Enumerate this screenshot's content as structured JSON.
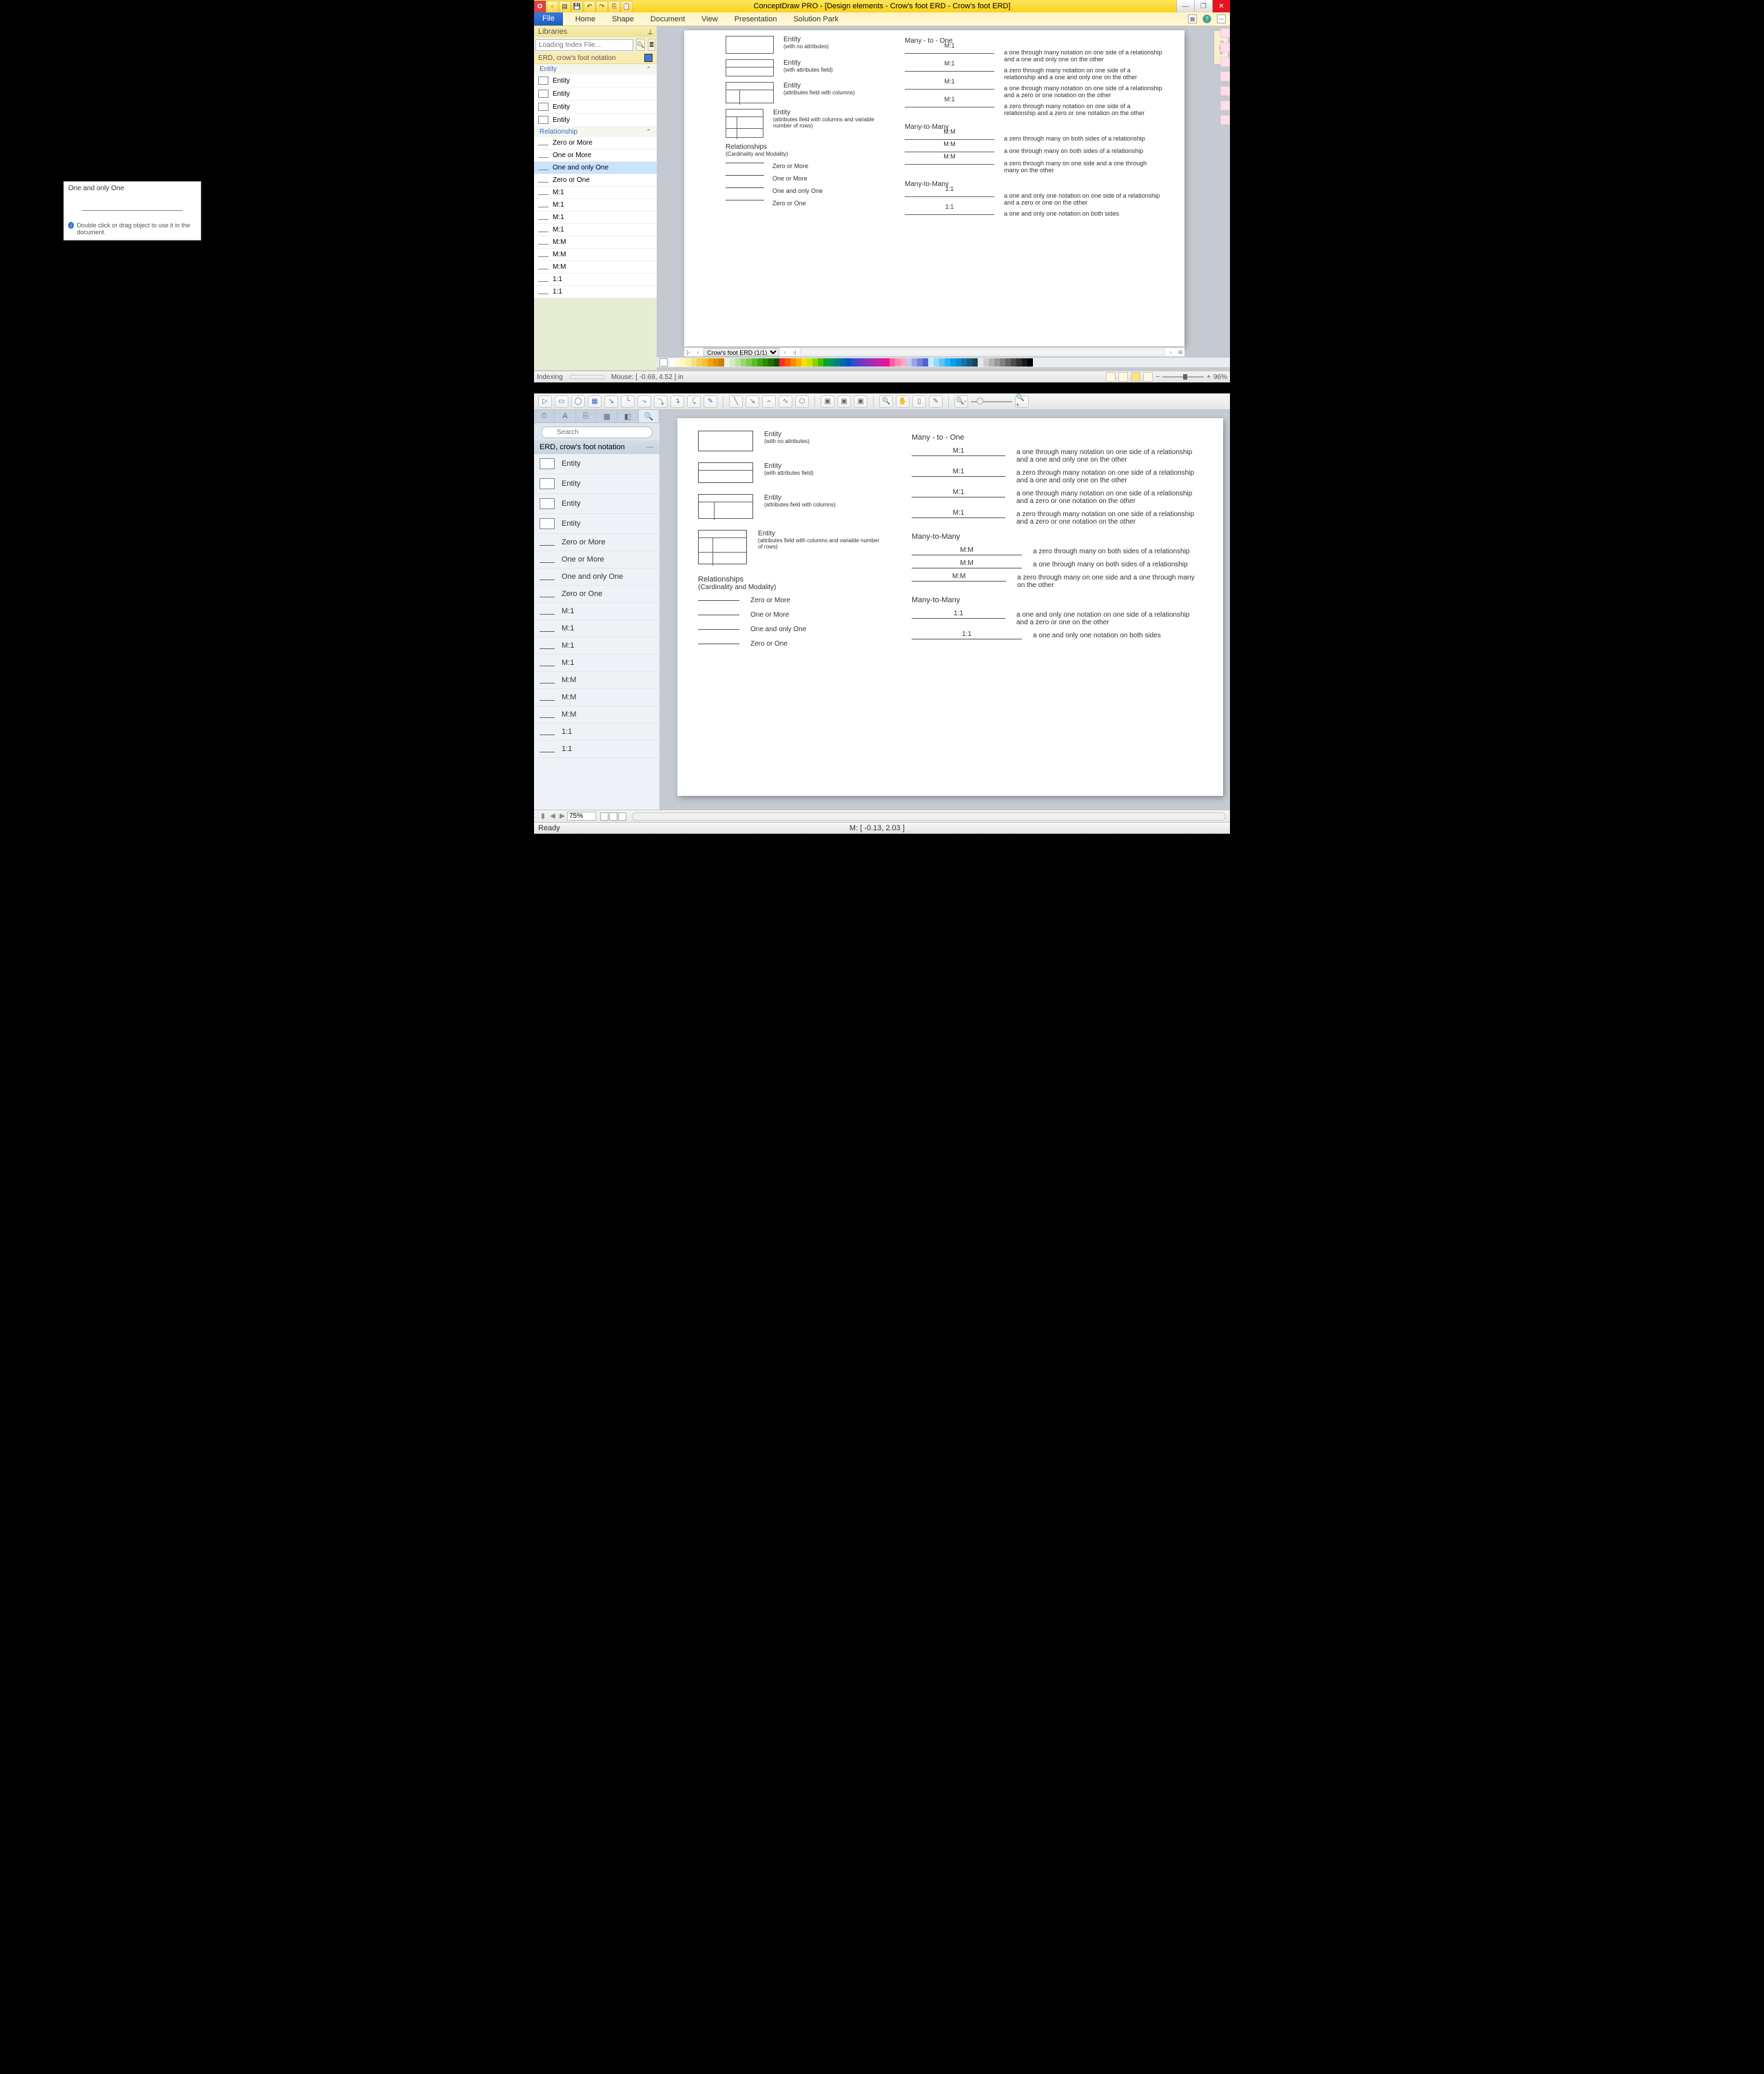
{
  "win": {
    "title": "ConceptDraw PRO - [Design elements - Crow's foot ERD - Crow's foot ERD]",
    "ribbon": [
      "File",
      "Home",
      "Shape",
      "Document",
      "View",
      "Presentation",
      "Solution Park"
    ],
    "libraries_title": "Libraries",
    "search_placeholder": "Loading Index File...",
    "lib_category": "ERD, crow's foot notation",
    "group_entity": "Entity",
    "group_relationship": "Relationship",
    "entities": [
      "Entity",
      "Entity",
      "Entity",
      "Entity"
    ],
    "relationships": [
      "Zero or More",
      "One or More",
      "One and only One",
      "Zero or One",
      "M:1",
      "M:1",
      "M:1",
      "M:1",
      "M:M",
      "M:M",
      "M:M",
      "1:1",
      "1:1"
    ],
    "tooltip_title": "One and only One",
    "tooltip_msg": "Double click or drag object to use it in the document.",
    "tab_name": "Crow's foot ERD (1/1)",
    "status_left": "Indexing",
    "status_mouse": "Mouse: [ -0.69, 4.52 ] in",
    "zoom": "96%"
  },
  "mac": {
    "search_placeholder": "Search",
    "lib_category": "ERD, crow's foot notation",
    "entities": [
      "Entity",
      "Entity",
      "Entity",
      "Entity"
    ],
    "relationships": [
      "Zero or More",
      "One or More",
      "One and only One",
      "Zero or One",
      "M:1",
      "M:1",
      "M:1",
      "M:1",
      "M:M",
      "M:M",
      "M:M",
      "1:1",
      "1:1"
    ],
    "zoom": "75%",
    "status_left": "Ready",
    "status_mouse": "M: [ -0.13, 2.03 ]"
  },
  "diagram": {
    "entities": [
      {
        "title": "Entity",
        "sub": "(with no attributes)",
        "h": 30
      },
      {
        "title": "Entity",
        "sub": "(with attributes field)",
        "h": 30,
        "rows": 1
      },
      {
        "title": "Entity",
        "sub": "(attributes field with columns)",
        "h": 36,
        "cols": true
      },
      {
        "title": "Entity",
        "sub": "(attributes field with columns and variable number of rows)",
        "h": 50,
        "cols": true,
        "multi": true
      }
    ],
    "rel_heading": "Relationships",
    "rel_sub": "(Cardinality and Modality)",
    "cards": [
      "Zero or More",
      "One or More",
      "One and only One",
      "Zero or One"
    ],
    "sec1": "Many - to - One",
    "m1": [
      {
        "lbl": "M:1",
        "tx": "a one through many notation on one side of a relationship and a one and only one on the other"
      },
      {
        "lbl": "M:1",
        "tx": "a zero through many notation on one side of a relationship and a one and only one on the other"
      },
      {
        "lbl": "M:1",
        "tx": "a one through many notation on one side of a relationship and a zero or one notation on the other"
      },
      {
        "lbl": "M:1",
        "tx": "a zero through many notation on one side of a relationship and a zero or one notation on the other"
      }
    ],
    "sec2": "Many-to-Many",
    "mm": [
      {
        "lbl": "M:M",
        "tx": "a zero through many on both sides of a relationship"
      },
      {
        "lbl": "M:M",
        "tx": "a one through many on both sides of a relationship"
      },
      {
        "lbl": "M:M",
        "tx": "a zero through many on one side and a one through many on the other"
      }
    ],
    "sec3": "Many-to-Many",
    "o1": [
      {
        "lbl": "1:1",
        "tx": "a one and only one notation on one side of a relationship and a zero or one on the other"
      },
      {
        "lbl": "1:1",
        "tx": "a one and only one notation on both sides"
      }
    ]
  },
  "palette": [
    "#ffffff",
    "#fefcd6",
    "#fdf9c0",
    "#fbefa6",
    "#f8e07e",
    "#f6cf4e",
    "#f5c12e",
    "#f3a400",
    "#e09000",
    "#ca7f00",
    "#e8f5de",
    "#d3ecc0",
    "#b9e19b",
    "#9dd475",
    "#7ec750",
    "#5db92d",
    "#3ca60c",
    "#2a8a00",
    "#1e6e00",
    "#145200",
    "#ff2a2a",
    "#f25d00",
    "#f68c00",
    "#f9b300",
    "#f5df00",
    "#cfe400",
    "#8fd000",
    "#4abc00",
    "#00a62f",
    "#009364",
    "#007e89",
    "#006aa8",
    "#0055c4",
    "#324ad0",
    "#5940c9",
    "#7b37c0",
    "#9a2eb6",
    "#b825ac",
    "#d41ca2",
    "#ed1397",
    "#ff5ea0",
    "#ff8cb4",
    "#ffa6c1",
    "#c3c7ed",
    "#9ca3e4",
    "#7680db",
    "#5260d2",
    "#c3ecff",
    "#8fd9fb",
    "#5cc5f7",
    "#2ab2f3",
    "#009fef",
    "#0d8bd0",
    "#1473a8",
    "#195b80",
    "#1c4459",
    "#e6e6e6",
    "#cccccc",
    "#b3b3b3",
    "#999999",
    "#808080",
    "#666666",
    "#4d4d4d",
    "#333333",
    "#1a1a1a",
    "#000000"
  ]
}
